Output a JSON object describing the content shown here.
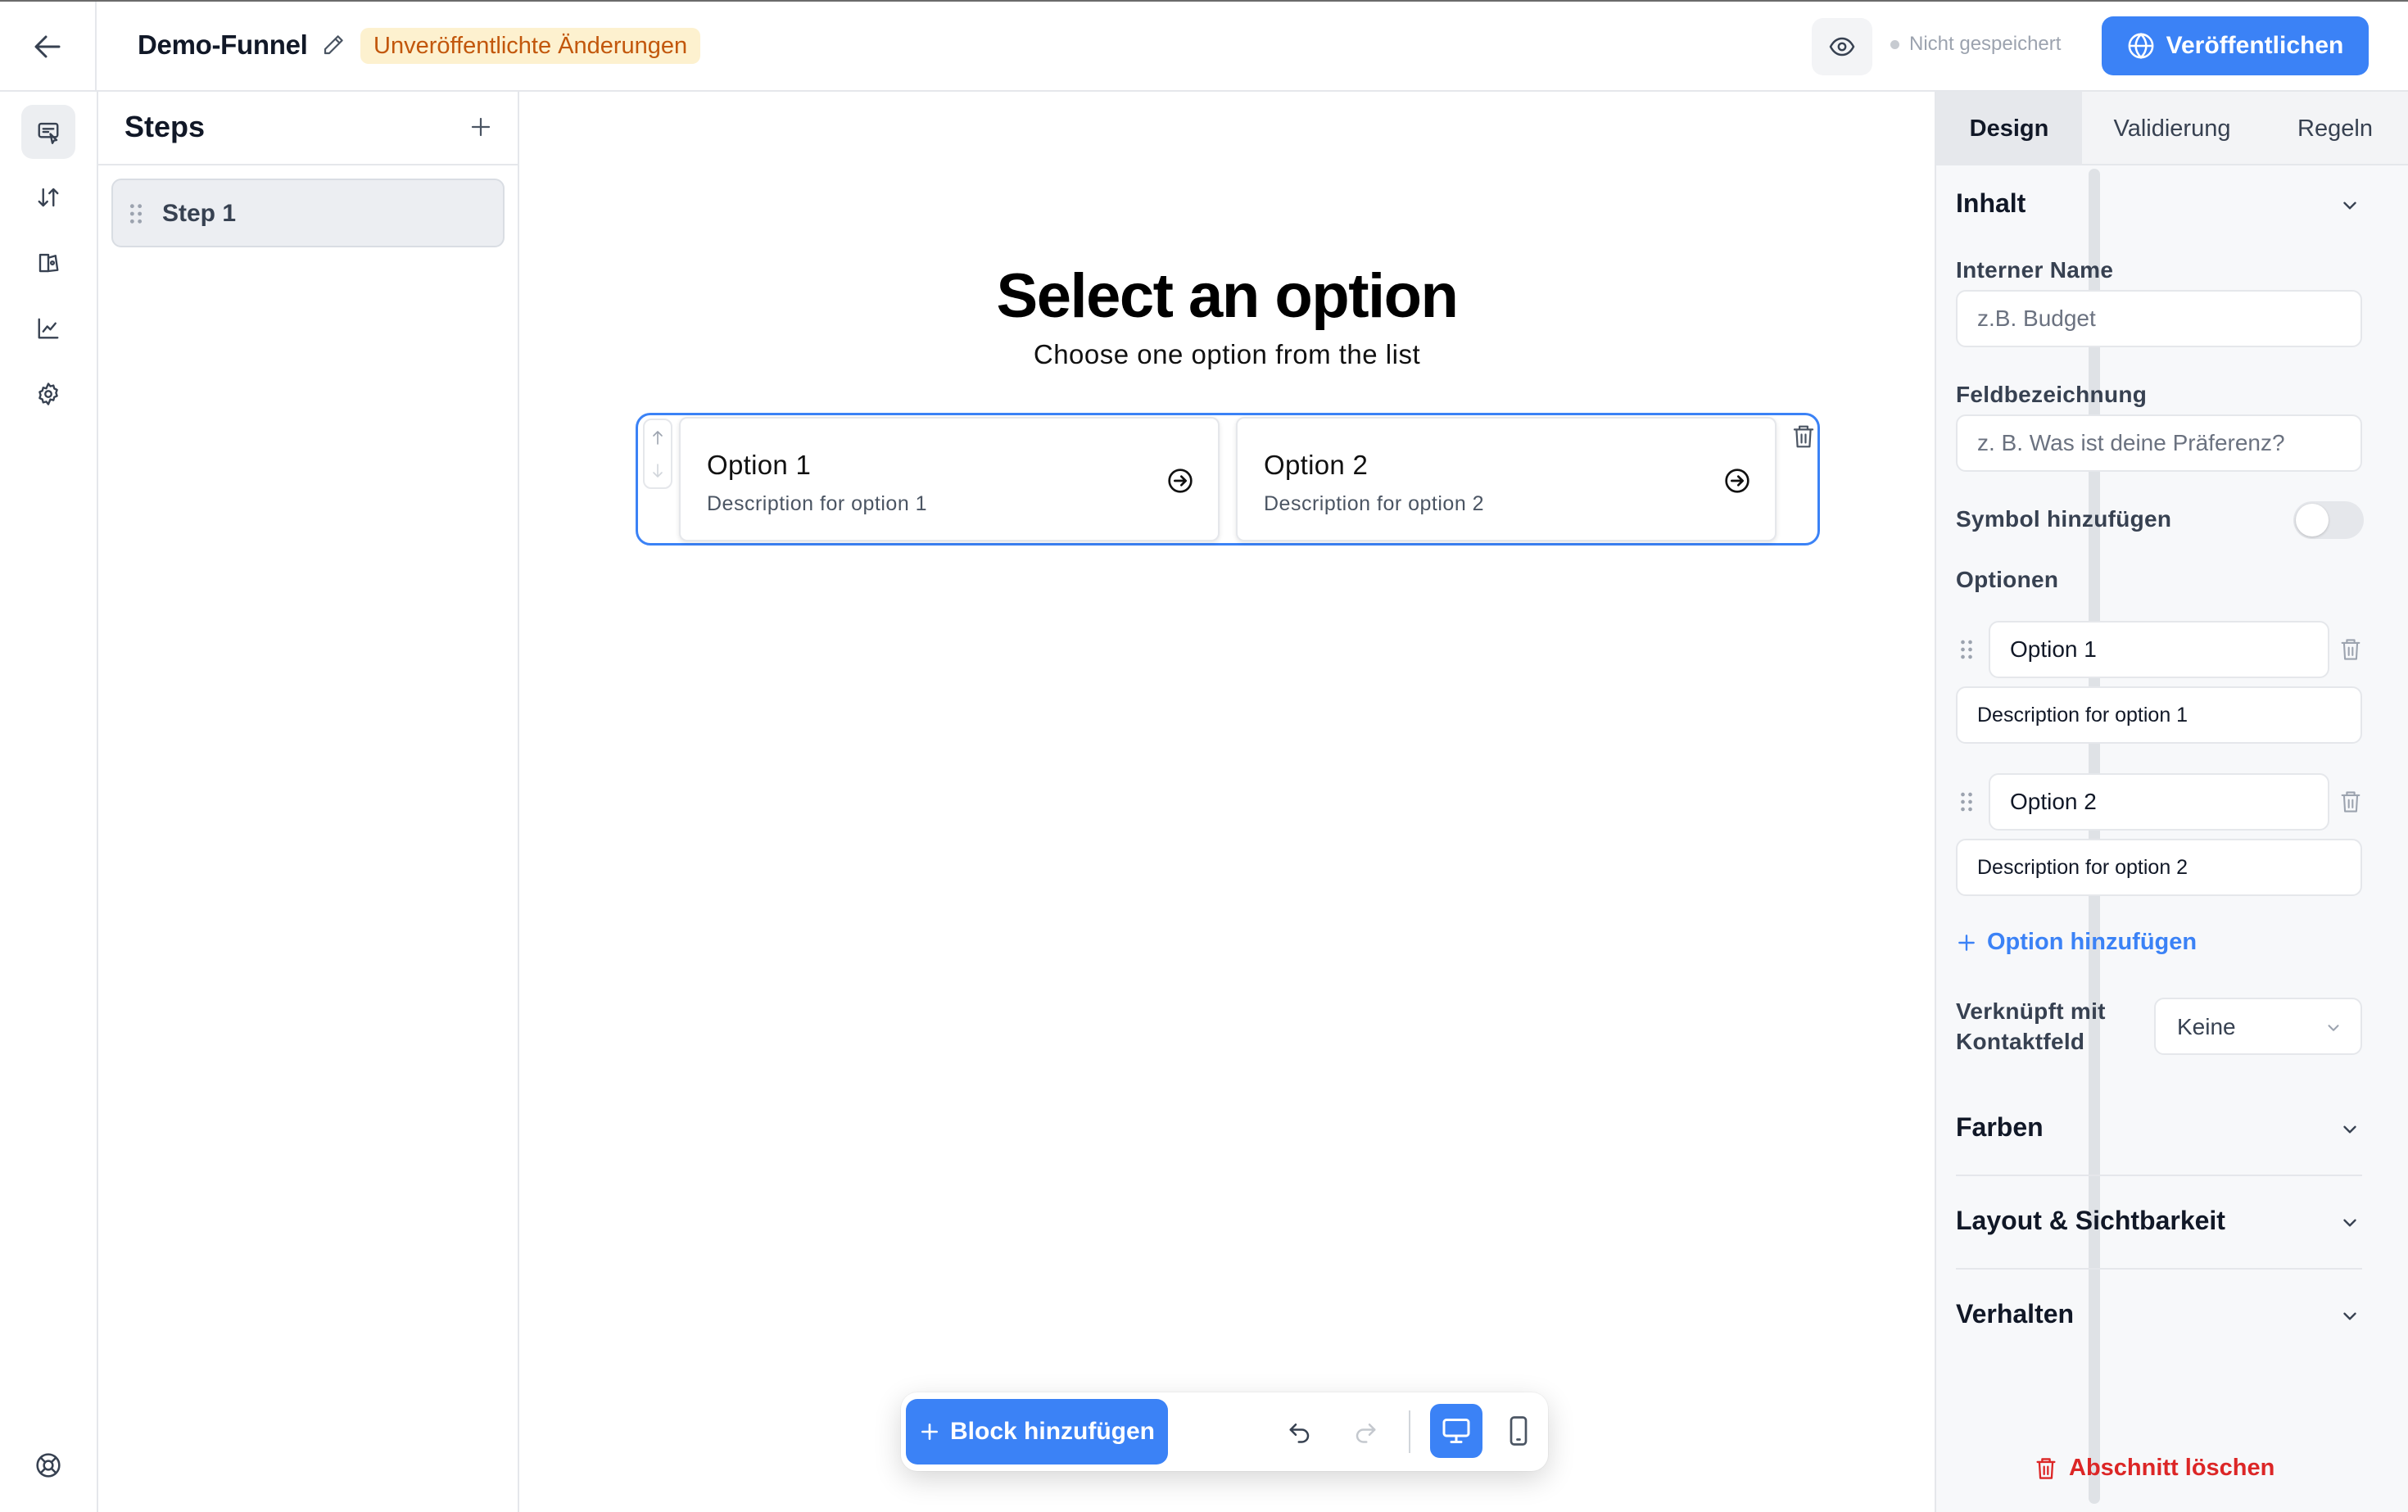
{
  "header": {
    "funnel_name": "Demo-Funnel",
    "unpublished_badge": "Unveröffentlichte Änderungen",
    "save_status": "Nicht gespeichert",
    "publish_label": "Veröffentlichen"
  },
  "rail": {
    "icons": [
      "editor-icon",
      "sort-icon",
      "pages-icon",
      "analytics-icon",
      "settings-icon",
      "help-icon"
    ]
  },
  "steps": {
    "title": "Steps",
    "items": [
      {
        "label": "Step 1"
      }
    ]
  },
  "canvas": {
    "title": "Select an option",
    "subtitle": "Choose one option from the list",
    "options": [
      {
        "title": "Option 1",
        "description": "Description for option 1"
      },
      {
        "title": "Option 2",
        "description": "Description for option 2"
      }
    ]
  },
  "toolbar": {
    "add_block_label": "Block hinzufügen"
  },
  "panel": {
    "tabs": [
      "Design",
      "Validierung",
      "Regeln"
    ],
    "active_tab": "Design",
    "content_section": "Inhalt",
    "internal_name_label": "Interner Name",
    "internal_name_placeholder": "z.B. Budget",
    "field_label_label": "Feldbezeichnung",
    "field_label_placeholder": "z. B. Was ist deine Präferenz?",
    "symbol_label": "Symbol hinzufügen",
    "symbol_enabled": false,
    "options_label": "Optionen",
    "options": [
      {
        "title": "Option 1",
        "description": "Description for option 1"
      },
      {
        "title": "Option 2",
        "description": "Description for option 2"
      }
    ],
    "add_option_label": "Option hinzufügen",
    "contact_field_label_1": "Verknüpft mit",
    "contact_field_label_2": "Kontaktfeld",
    "contact_field_value": "Keine",
    "sections": [
      "Farben",
      "Layout & Sichtbarkeit",
      "Verhalten"
    ],
    "delete_section_label": "Abschnitt löschen"
  },
  "colors": {
    "accent": "#3b82f6",
    "badge_bg": "#fdf1cf",
    "badge_text": "#c2570c",
    "danger": "#dc2626"
  }
}
